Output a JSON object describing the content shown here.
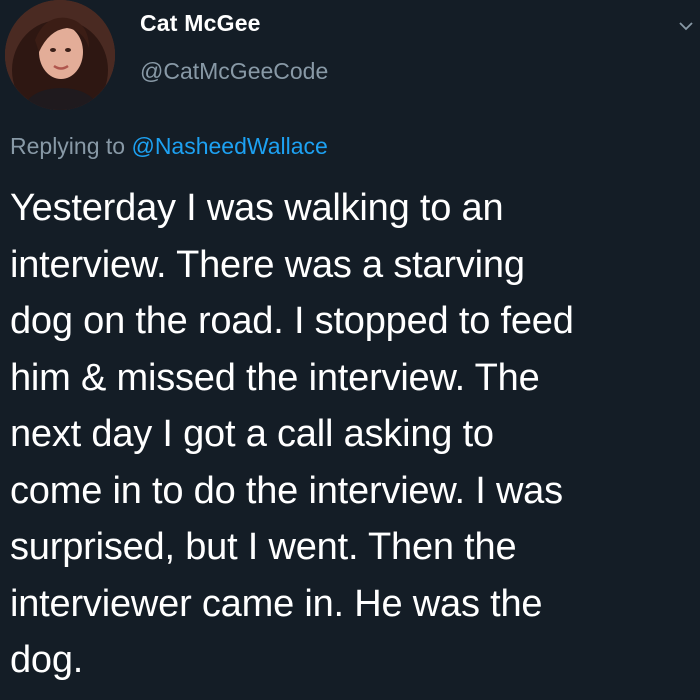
{
  "author": {
    "display_name": "Cat McGee",
    "handle": "@CatMcGeeCode",
    "avatar_icon": "profile-photo"
  },
  "reply": {
    "prefix": "Replying to ",
    "mention": "@NasheedWallace"
  },
  "tweet": {
    "text": "Yesterday I was walking to an\ninterview. There was a starving\ndog on the road. I stopped to feed\nhim & missed the interview. The\nnext day I got a call asking to\ncome in to do the interview. I was\nsurprised, but I went. Then the\ninterviewer came in. He was the\ndog."
  },
  "colors": {
    "background": "#141d26",
    "text_primary": "#ffffff",
    "text_secondary": "#8899a6",
    "link": "#1da1f2"
  },
  "icons": {
    "menu": "chevron-down-icon"
  }
}
